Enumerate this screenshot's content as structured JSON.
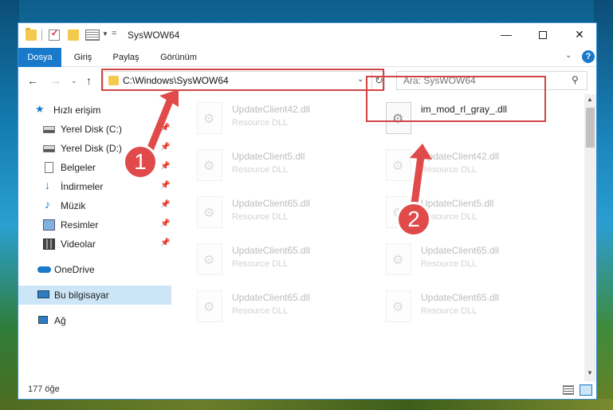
{
  "window": {
    "title": "SysWOW64",
    "controls": {
      "minimize": "—",
      "maximize": "",
      "close": "✕"
    }
  },
  "ribbon": {
    "tabs": [
      {
        "label": "Dosya",
        "active": true
      },
      {
        "label": "Giriş"
      },
      {
        "label": "Paylaş"
      },
      {
        "label": "Görünüm"
      }
    ],
    "help": "?"
  },
  "address": {
    "path": "C:\\Windows\\SysWOW64",
    "refresh_icon": "↻"
  },
  "search": {
    "placeholder": "Ara: SysWOW64"
  },
  "nav_pane": {
    "items": [
      {
        "label": "Hızlı erişim",
        "icon": "star-icon"
      },
      {
        "label": "Yerel Disk (C:)",
        "icon": "disk-icon",
        "pinned": true
      },
      {
        "label": "Yerel Disk (D:)",
        "icon": "disk-icon",
        "pinned": true
      },
      {
        "label": "Belgeler",
        "icon": "document-icon",
        "pinned": true
      },
      {
        "label": "İndirmeler",
        "icon": "download-icon",
        "pinned": true
      },
      {
        "label": "Müzik",
        "icon": "music-icon",
        "pinned": true
      },
      {
        "label": "Resimler",
        "icon": "pictures-icon",
        "pinned": true
      },
      {
        "label": "Videolar",
        "icon": "video-icon",
        "pinned": true
      },
      {
        "label": "OneDrive",
        "icon": "cloud-icon"
      },
      {
        "label": "Bu bilgisayar",
        "icon": "computer-icon",
        "selected": true
      },
      {
        "label": "Ağ",
        "icon": "network-icon"
      }
    ]
  },
  "files": [
    {
      "name": "UpdateClient42.dll",
      "type": "Resource DLL",
      "faded": true
    },
    {
      "name": "im_mod_rl_gray_.dll",
      "type": "",
      "faded": false
    },
    {
      "name": "UpdateClient5.dll",
      "type": "Resource DLL",
      "faded": true
    },
    {
      "name": "UpdateClient42.dll",
      "type": "Resource DLL",
      "faded": true
    },
    {
      "name": "UpdateClient65.dll",
      "type": "Resource DLL",
      "faded": true
    },
    {
      "name": "UpdateClient5.dll",
      "type": "Resource DLL",
      "faded": true
    },
    {
      "name": "UpdateClient65.dll",
      "type": "Resource DLL",
      "faded": true
    },
    {
      "name": "UpdateClient65.dll",
      "type": "Resource DLL",
      "faded": true
    },
    {
      "name": "UpdateClient65.dll",
      "type": "Resource DLL",
      "faded": true
    },
    {
      "name": "UpdateClient65.dll",
      "type": "Resource DLL",
      "faded": true
    }
  ],
  "status": {
    "count_text": "177 öğe"
  },
  "annotations": {
    "step1": "1",
    "step2": "2",
    "accent": "#e04a4a"
  }
}
